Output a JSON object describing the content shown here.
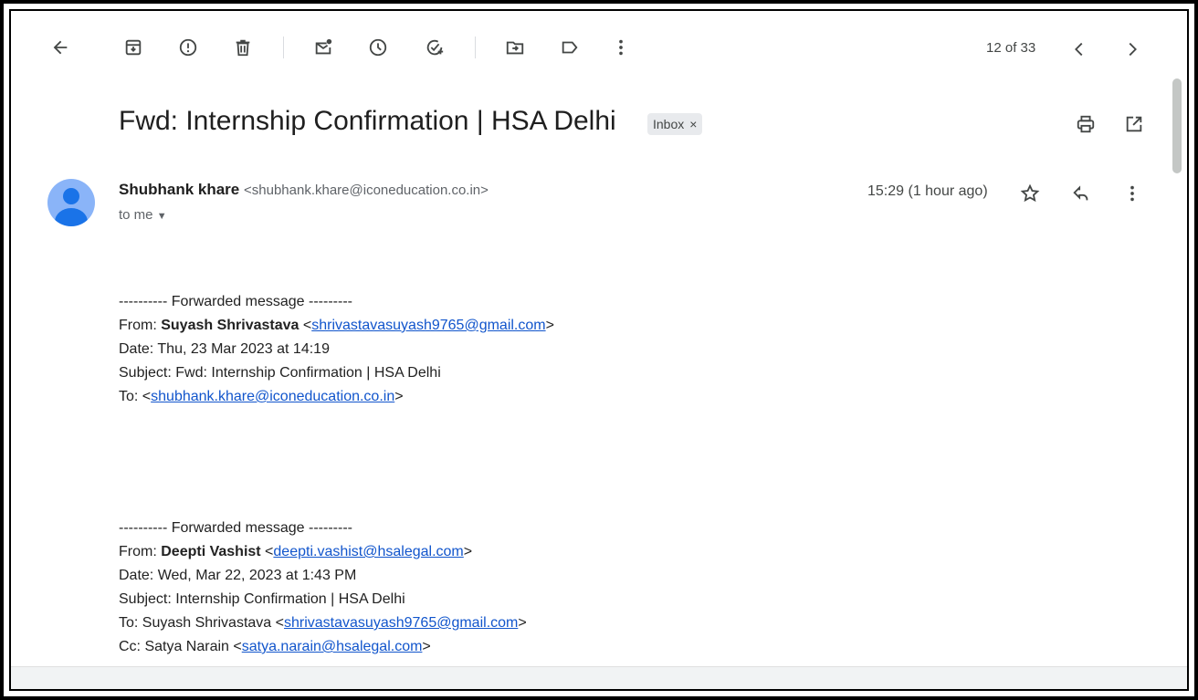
{
  "toolbar": {
    "back_icon": "arrow-left-icon",
    "archive_icon": "archive-icon",
    "spam_icon": "report-spam-icon",
    "delete_icon": "trash-icon",
    "mark_unread_icon": "mark-unread-icon",
    "snooze_icon": "clock-icon",
    "add_task_icon": "add-task-icon",
    "move_icon": "move-to-icon",
    "label_icon": "label-icon",
    "more_icon": "more-vertical-icon",
    "counter": "12 of 33"
  },
  "email": {
    "subject": "Fwd: Internship Confirmation | HSA Delhi",
    "label": "Inbox",
    "sender_name": "Shubhank khare",
    "sender_email": "<shubhank.khare@iconeducation.co.in>",
    "to_me": "to me",
    "time": "15:29 (1 hour ago)"
  },
  "forward1": {
    "header": "---------- Forwarded message ---------",
    "from_label": "From:",
    "from_name": "Suyash Shrivastava",
    "from_email": "shrivastavasuyash9765@gmail.com",
    "date": "Date: Thu, 23 Mar 2023 at 14:19",
    "subject": "Subject: Fwd: Internship Confirmation | HSA Delhi",
    "to_label": "To:",
    "to_email": "shubhank.khare@iconeducation.co.in"
  },
  "forward2": {
    "header": "---------- Forwarded message ---------",
    "from_label": "From:",
    "from_name": "Deepti Vashist",
    "from_email": "deepti.vashist@hsalegal.com",
    "date": "Date: Wed, Mar 22, 2023 at 1:43 PM",
    "subject": "Subject: Internship Confirmation | HSA Delhi",
    "to_prefix": "To: Suyash Shrivastava",
    "to_email": "shrivastavasuyash9765@gmail.com",
    "cc_prefix": "Cc: Satya Narain",
    "cc_email": "satya.narain@hsalegal.com"
  },
  "colors": {
    "link": "#1155cc",
    "avatar_bg": "#8ab4f8",
    "avatar_fg": "#1a73e8"
  }
}
